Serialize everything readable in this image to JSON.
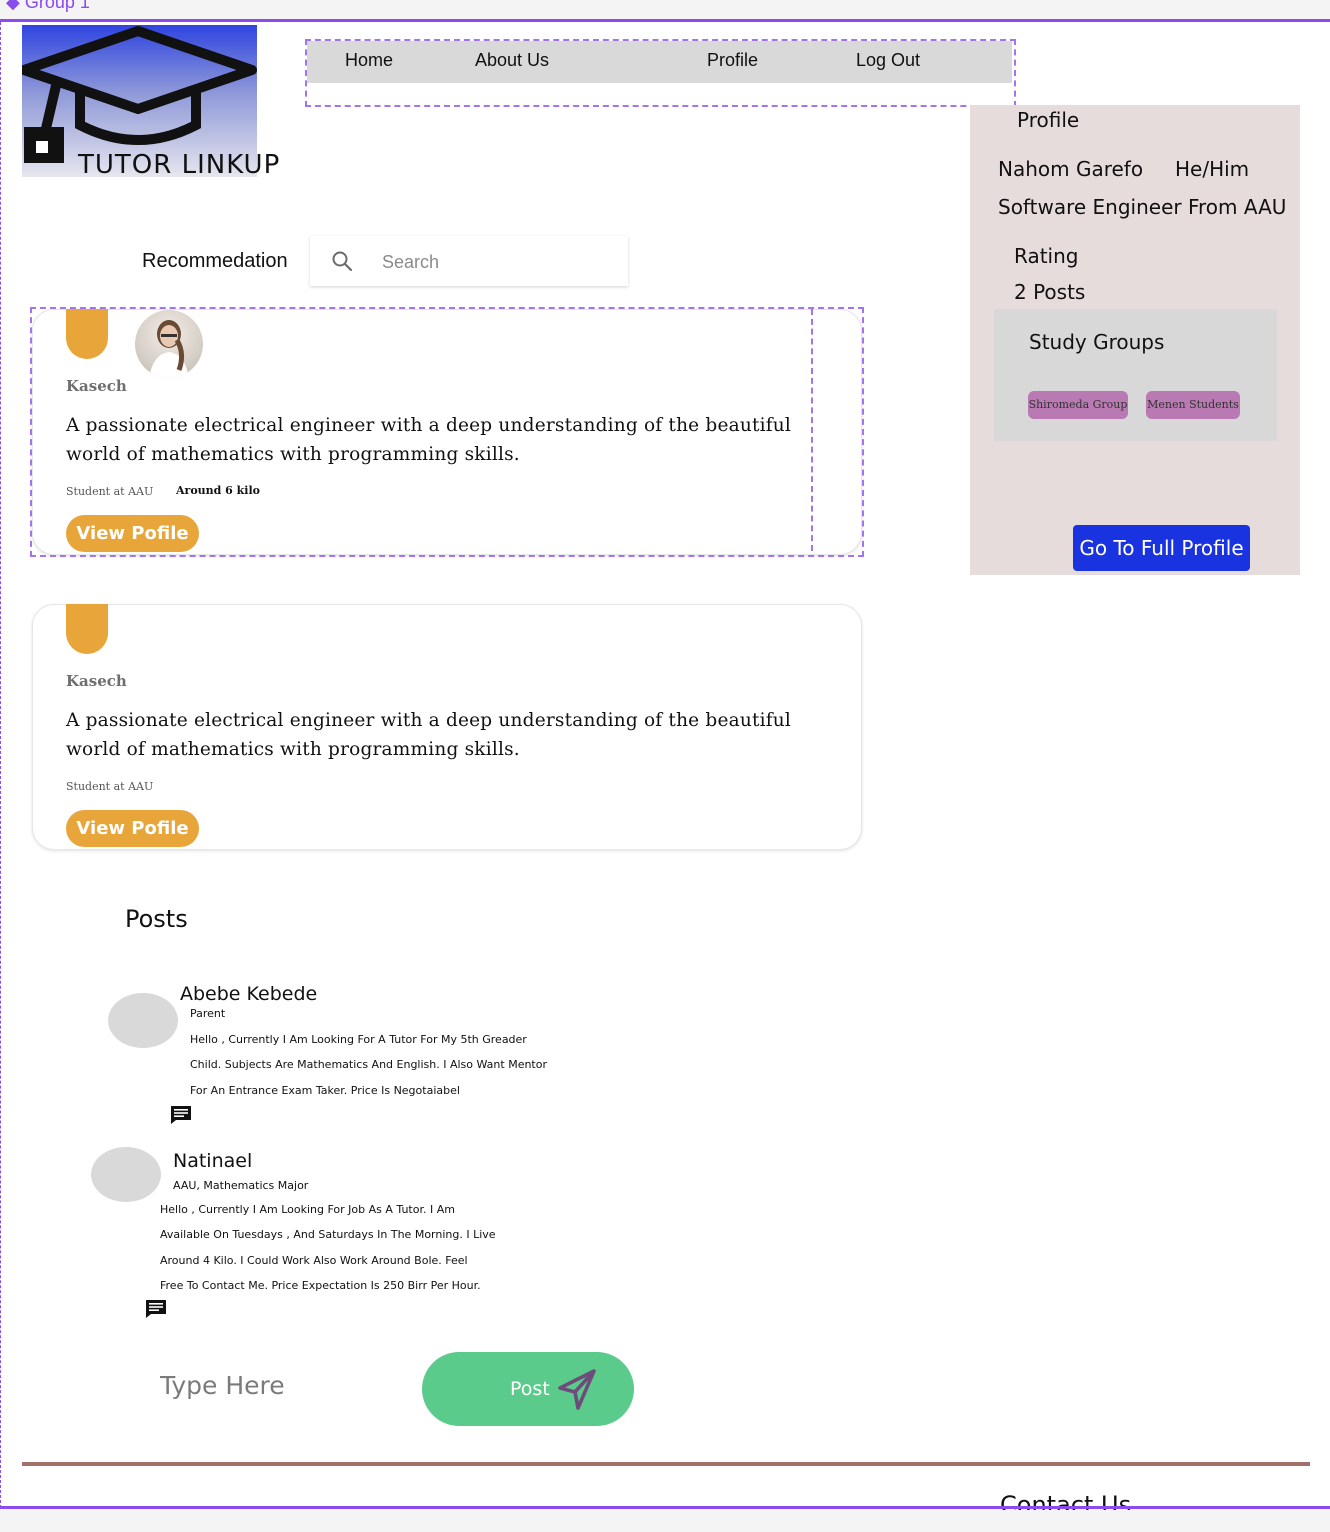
{
  "frame": {
    "label": "◆ Group 1"
  },
  "logo": {
    "text": "TUTOR LINKUP"
  },
  "nav": {
    "items": [
      {
        "label": "Home"
      },
      {
        "label": "About Us"
      },
      {
        "label": "Profile"
      },
      {
        "label": "Log Out"
      }
    ]
  },
  "search": {
    "recommendation_label": "Recommedation",
    "placeholder": "Search"
  },
  "cards": [
    {
      "name": "Kasech",
      "description_line1": "A passionate electrical engineer with a deep understanding of the beautiful",
      "description_line2": "world of mathematics with programming skills.",
      "role": "Student at AAU",
      "distance": "Around 6 kilo",
      "button": "View Pofile"
    },
    {
      "name": "Kasech",
      "description_line1": "A passionate electrical engineer with a deep understanding of the beautiful",
      "description_line2": "world of mathematics with programming skills.",
      "role": "Student at AAU",
      "button": "View Pofile"
    }
  ],
  "profile": {
    "title": "Profile",
    "name": "Nahom Garefo",
    "pronouns": "He/Him",
    "headline": "Software Engineer From AAU",
    "rating_label": "Rating",
    "posts_count": "2 Posts",
    "study_groups_title": "Study Groups",
    "groups": [
      "Shiromeda Group",
      "Menen Students"
    ],
    "full_profile_button": "Go To Full Profile",
    "colors": {
      "button": "#1a33e0",
      "panel": "#e6dcdc",
      "chip": "#b979b2"
    }
  },
  "posts": {
    "title": "Posts",
    "items": [
      {
        "author": "Abebe Kebede",
        "role": "Parent",
        "lines": [
          "Hello , Currently I Am Looking For A Tutor For My 5th Greader",
          "Child. Subjects Are Mathematics And English. I Also Want Mentor",
          "For An Entrance Exam Taker. Price Is Negotaiabel"
        ]
      },
      {
        "author": "Natinael",
        "role": "AAU, Mathematics Major",
        "lines": [
          "Hello , Currently I Am Looking For Job As A Tutor. I Am",
          "Available On Tuesdays , And Saturdays In The Morning. I Live",
          "Around 4 Kilo. I Could Work Also Work Around Bole. Feel",
          "Free To Contact Me. Price Expectation Is 250 Birr Per Hour."
        ]
      }
    ],
    "composer_placeholder": "Type Here",
    "post_button": "Post"
  },
  "footer": {
    "contact": "Contact Us"
  },
  "colors": {
    "accent_orange": "#e8a53a",
    "post_green": "#5bcb8b",
    "frame_purple": "#8a4bef"
  }
}
